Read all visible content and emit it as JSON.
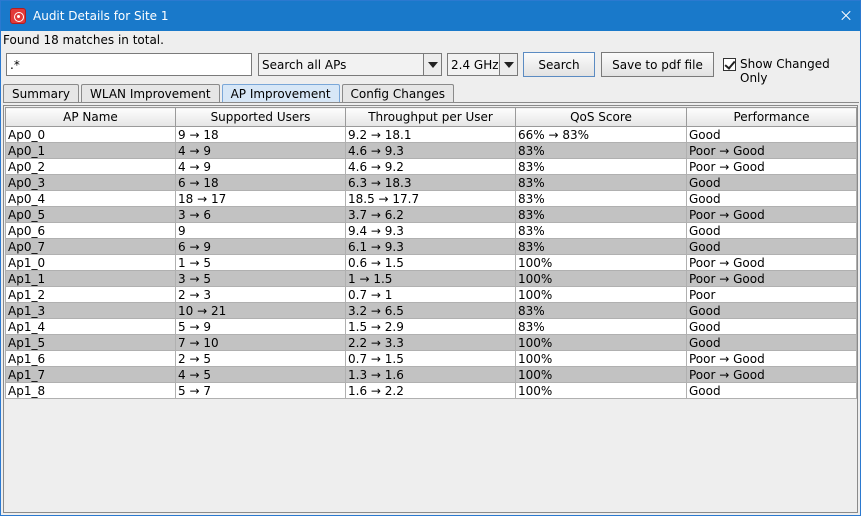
{
  "window": {
    "title": "Audit Details for Site 1",
    "icon": "app-logo-icon"
  },
  "status": {
    "matches": "Found 18 matches in total."
  },
  "toolbar": {
    "search_value": ".*",
    "ap_filter": "Search all APs",
    "band": "2.4 GHz",
    "search_label": "Search",
    "pdf_label": "Save to pdf file",
    "show_changed_label": "Show Changed Only",
    "show_changed_checked": true
  },
  "tabs": [
    {
      "label": "Summary"
    },
    {
      "label": "WLAN Improvement"
    },
    {
      "label": "AP Improvement"
    },
    {
      "label": "Config Changes"
    }
  ],
  "active_tab": "AP Improvement",
  "table": {
    "columns": [
      "AP Name",
      "Supported Users",
      "Throughput per User",
      "QoS Score",
      "Performance"
    ],
    "rows": [
      [
        "Ap0_0",
        "9 → 18",
        "9.2 → 18.1",
        "66% → 83%",
        "Good"
      ],
      [
        "Ap0_1",
        "4 → 9",
        "4.6 → 9.3",
        "83%",
        "Poor → Good"
      ],
      [
        "Ap0_2",
        "4 → 9",
        "4.6 → 9.2",
        "83%",
        "Poor → Good"
      ],
      [
        "Ap0_3",
        "6 → 18",
        "6.3 → 18.3",
        "83%",
        "Good"
      ],
      [
        "Ap0_4",
        "18 → 17",
        "18.5 → 17.7",
        "83%",
        "Good"
      ],
      [
        "Ap0_5",
        "3 → 6",
        "3.7 → 6.2",
        "83%",
        "Poor → Good"
      ],
      [
        "Ap0_6",
        "9",
        "9.4 → 9.3",
        "83%",
        "Good"
      ],
      [
        "Ap0_7",
        "6 → 9",
        "6.1 → 9.3",
        "83%",
        "Good"
      ],
      [
        "Ap1_0",
        "1 → 5",
        "0.6 → 1.5",
        "100%",
        "Poor → Good"
      ],
      [
        "Ap1_1",
        "3 → 5",
        "1 → 1.5",
        "100%",
        "Poor → Good"
      ],
      [
        "Ap1_2",
        "2 → 3",
        "0.7 → 1",
        "100%",
        "Poor"
      ],
      [
        "Ap1_3",
        "10 → 21",
        "3.2 → 6.5",
        "83%",
        "Good"
      ],
      [
        "Ap1_4",
        "5 → 9",
        "1.5 → 2.9",
        "83%",
        "Good"
      ],
      [
        "Ap1_5",
        "7 → 10",
        "2.2 → 3.3",
        "100%",
        "Good"
      ],
      [
        "Ap1_6",
        "2 → 5",
        "0.7 → 1.5",
        "100%",
        "Poor → Good"
      ],
      [
        "Ap1_7",
        "4 → 5",
        "1.3 → 1.6",
        "100%",
        "Poor → Good"
      ],
      [
        "Ap1_8",
        "5 → 7",
        "1.6 → 2.2",
        "100%",
        "Good"
      ]
    ]
  }
}
